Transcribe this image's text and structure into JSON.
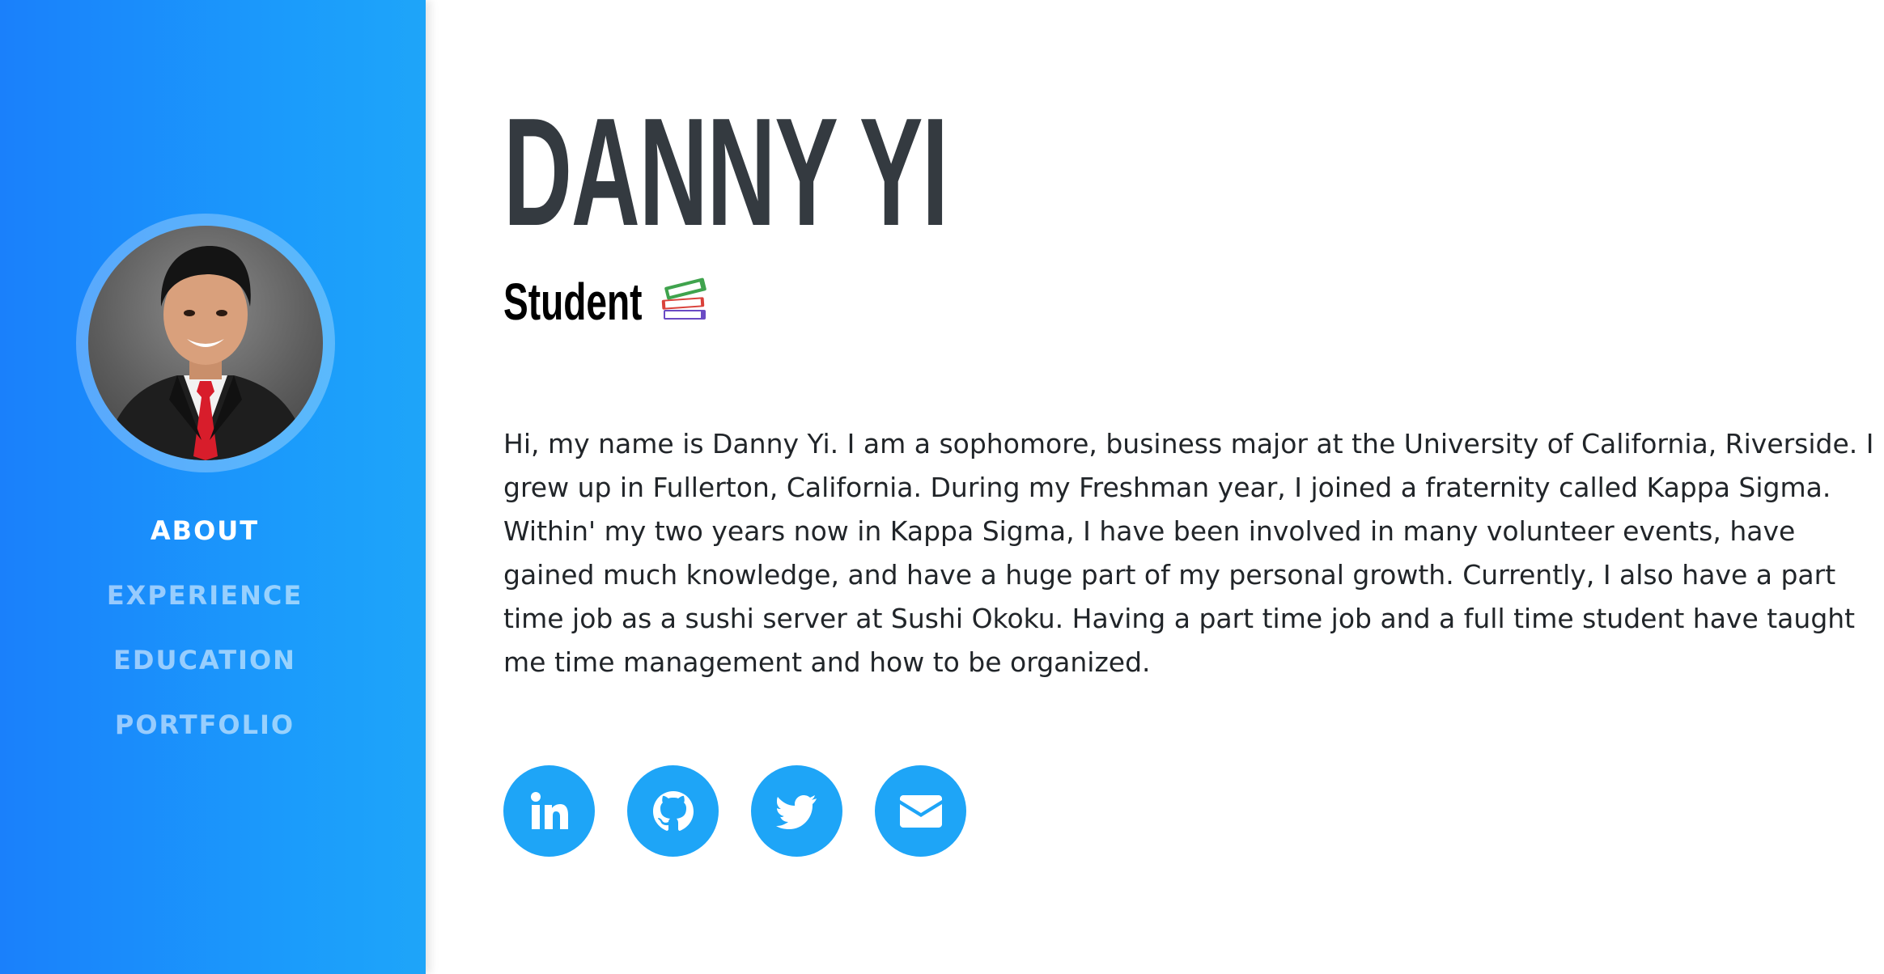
{
  "profile": {
    "name": "DANNY YI",
    "subtitle": "Student",
    "subtitle_icon": "books-icon",
    "avatar_alt": "profile-photo"
  },
  "nav": {
    "items": [
      {
        "label": "ABOUT",
        "active": true
      },
      {
        "label": "EXPERIENCE",
        "active": false
      },
      {
        "label": "EDUCATION",
        "active": false
      },
      {
        "label": "PORTFOLIO",
        "active": false
      }
    ]
  },
  "bio": {
    "text": "Hi, my name is Danny Yi. I am a sophomore, business major at the University of California, Riverside. I grew up in Fullerton, California. During my Freshman year, I joined a fraternity called Kappa Sigma. Within' my two years now in Kappa Sigma, I have been involved in many volunteer events, have gained much knowledge, and have a huge part of my personal growth. Currently, I also have a part time job as a sushi server at Sushi Okoku. Having a part time job and a full time student have taught me time management and how to be organized."
  },
  "socials": [
    {
      "icon": "linkedin-icon"
    },
    {
      "icon": "github-icon"
    },
    {
      "icon": "twitter-icon"
    },
    {
      "icon": "email-icon"
    }
  ],
  "colors": {
    "sidebar_start": "#1a80fb",
    "sidebar_end": "#1ea5f9",
    "accent": "#1ea5f7",
    "heading": "#343a40",
    "body_text": "#212529",
    "nav_active": "#ffffff",
    "nav_inactive": "rgba(255,255,255,0.55)"
  }
}
